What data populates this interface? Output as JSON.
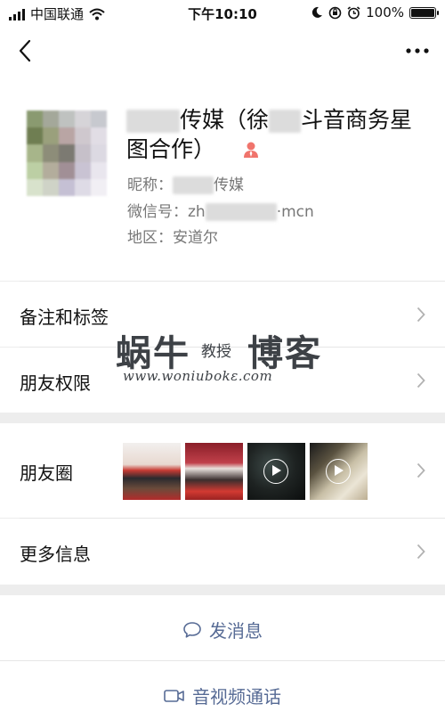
{
  "status_bar": {
    "carrier": "中国联通",
    "time": "下午10:10",
    "battery": "100%",
    "battery_level": 1.0
  },
  "navbar": {
    "back_icon": "chevron-left-icon",
    "more_icon": "ellipsis-icon"
  },
  "profile": {
    "name_part1": "传媒（徐",
    "name_part2": "斗音商务星图合作）",
    "nickname_label": "昵称：",
    "nickname_value": "传媒",
    "wechat_id_label": "微信号：",
    "wechat_id_prefix": "zh",
    "wechat_id_suffix": "·mcn",
    "region_label": "地区：",
    "region_value": "安道尔",
    "contact_icon_color": "#f0746c"
  },
  "rows": {
    "remarks_tags": "备注和标签",
    "friend_permissions": "朋友权限",
    "moments": "朋友圈",
    "more_info": "更多信息"
  },
  "watermark": {
    "brand_big1": "蜗牛",
    "brand_small": "教授",
    "brand_big2": "博客",
    "url": "www.woniubokε.com"
  },
  "actions": {
    "send_message": "发消息",
    "video_call": "音视频通话"
  },
  "colors": {
    "link_blue": "#576b95",
    "background": "#ededed"
  }
}
